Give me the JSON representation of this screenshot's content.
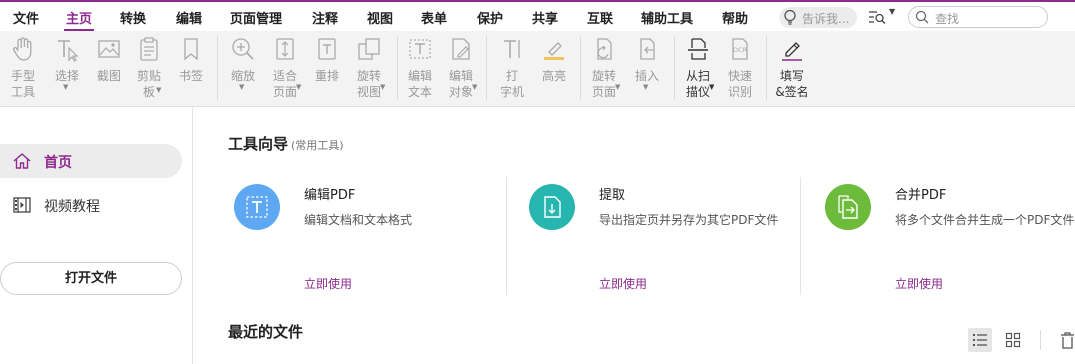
{
  "menu": {
    "items": [
      "文件",
      "主页",
      "转换",
      "编辑",
      "页面管理",
      "注释",
      "视图",
      "表单",
      "保护",
      "共享",
      "互联",
      "辅助工具",
      "帮助"
    ],
    "active_index": 1,
    "tell_me_placeholder": "告诉我...",
    "search_placeholder": "查找"
  },
  "ribbon": {
    "hand": [
      "手型",
      "工具"
    ],
    "select": [
      "选择"
    ],
    "snapshot": [
      "截图"
    ],
    "clipboard": [
      "剪贴",
      "板"
    ],
    "bookmark": [
      "书签"
    ],
    "zoom": [
      "缩放"
    ],
    "fit_page": [
      "适合",
      "页面"
    ],
    "reflow": [
      "重排"
    ],
    "rotate_view": [
      "旋转",
      "视图"
    ],
    "edit_text": [
      "编辑",
      "文本"
    ],
    "edit_object": [
      "编辑",
      "对象"
    ],
    "typewriter": [
      "打",
      "字机"
    ],
    "highlight": [
      "高亮"
    ],
    "rotate_page": [
      "旋转",
      "页面"
    ],
    "insert": [
      "插入"
    ],
    "from_scanner": [
      "从扫",
      "描仪"
    ],
    "quick_ocr": [
      "快速",
      "识别"
    ],
    "fill_sign": [
      "填写",
      "&签名"
    ]
  },
  "sidebar": {
    "home": "首页",
    "video": "视频教程",
    "open_file": "打开文件"
  },
  "main": {
    "tool_guide_title": "工具向导",
    "tool_guide_sub": "(常用工具)",
    "cards": [
      {
        "title": "编辑PDF",
        "desc": "编辑文档和文本格式",
        "link": "立即使用"
      },
      {
        "title": "提取",
        "desc": "导出指定页并另存为其它PDF文件",
        "link": "立即使用"
      },
      {
        "title": "合并PDF",
        "desc": "将多个文件合并生成一个PDF文件",
        "link": "立即使用"
      }
    ],
    "recent_title": "最近的文件"
  },
  "colors": {
    "accent": "#8e2a8e",
    "card_blue": "#5ea8f3",
    "card_teal": "#27b5b0",
    "card_green": "#6dbb3a"
  }
}
